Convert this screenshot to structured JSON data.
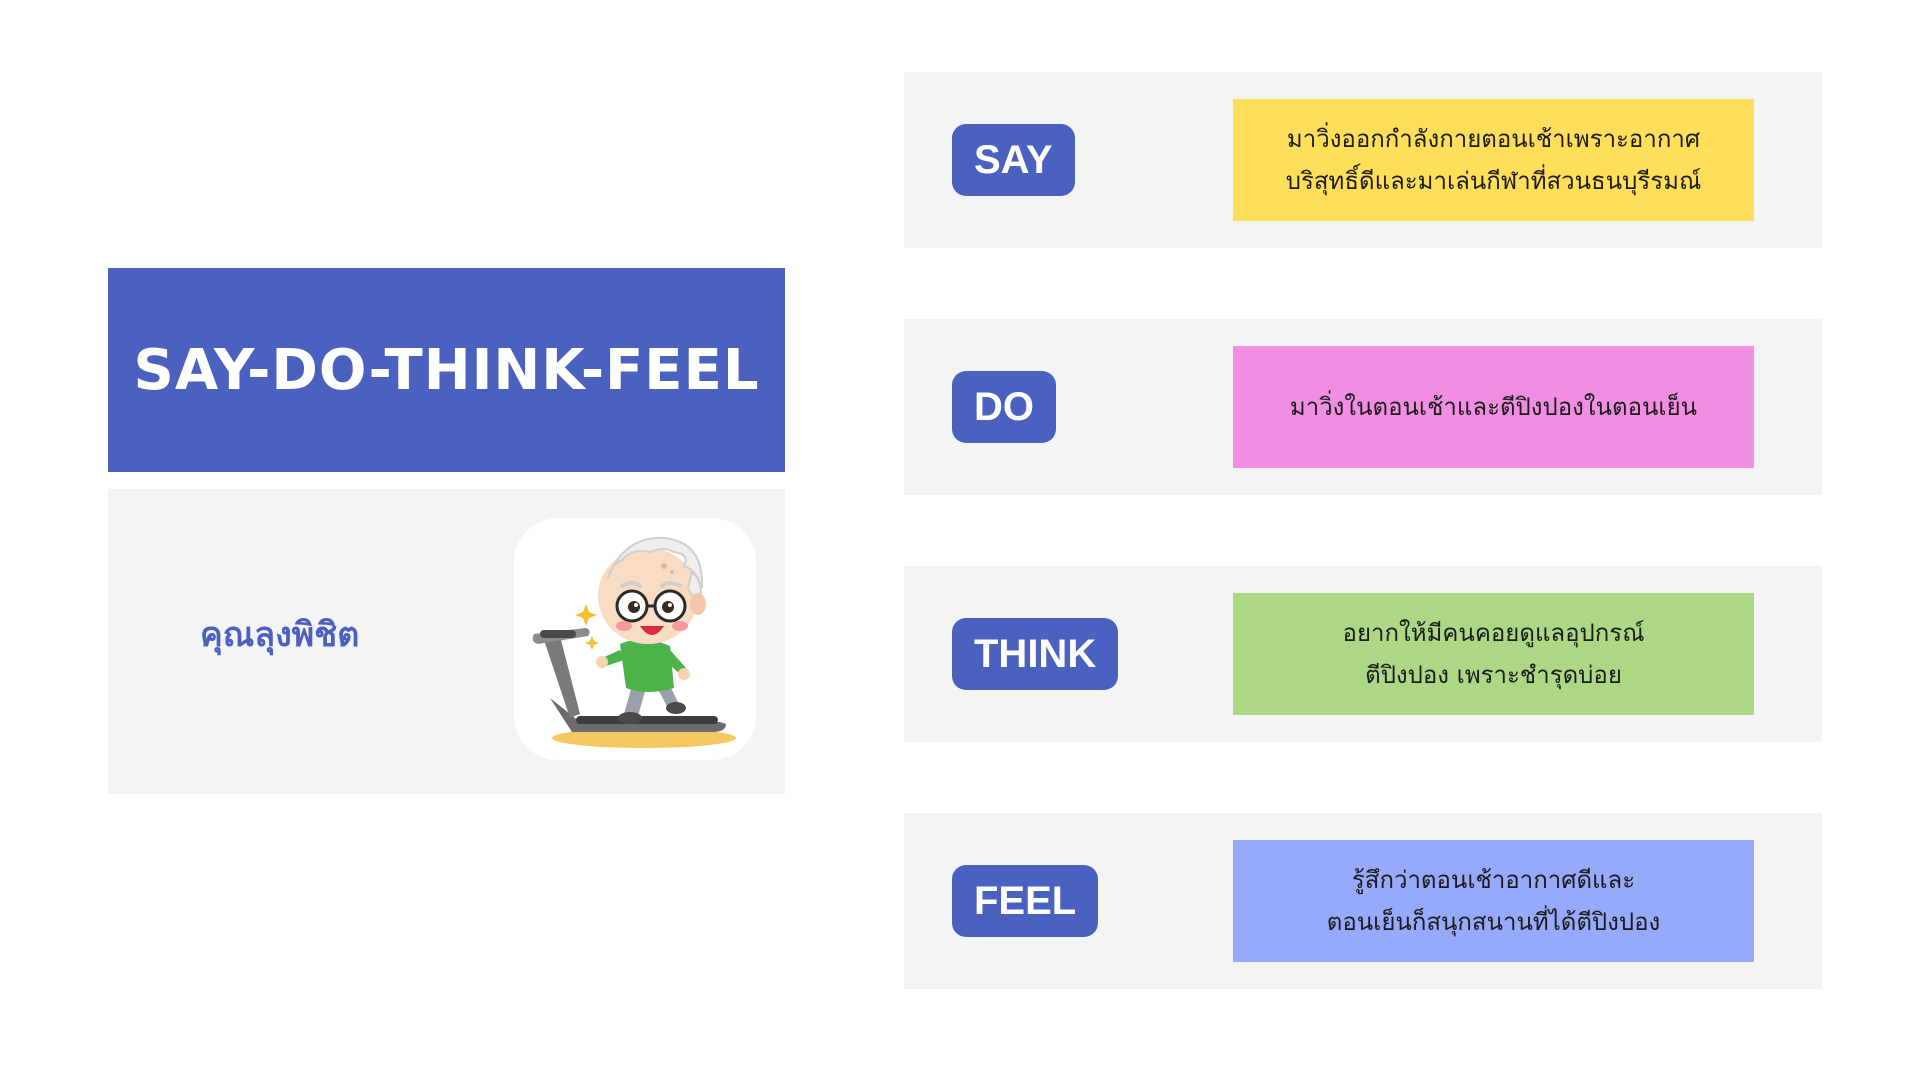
{
  "title": "SAY-DO-THINK-FEEL",
  "persona": {
    "name": "คุณลุงพิชิต",
    "avatar_icon": "elderly-man-on-treadmill-illustration"
  },
  "colors": {
    "accent": "#4b61c0",
    "panel": "#f4f4f4",
    "say": "#ffde59",
    "do": "#f28ee2",
    "think": "#acd886",
    "feel": "#97a9fa"
  },
  "rows": [
    {
      "label": "SAY",
      "lines": [
        "มาวิ่งออกกำลังกายตอนเช้าเพราะอากาศ",
        "บริสุทธิ์ดีและมาเล่นกีฬาที่สวนธนบุรีรมณ์"
      ]
    },
    {
      "label": "DO",
      "lines": [
        "มาวิ่งในตอนเช้าและตีปิงปองในตอนเย็น"
      ]
    },
    {
      "label": "THINK",
      "lines": [
        "อยากให้มีคนคอยดูแลอุปกรณ์",
        "ตีปิงปอง เพราะชำรุดบ่อย"
      ]
    },
    {
      "label": "FEEL",
      "lines": [
        "รู้สึกว่าตอนเช้าอากาศดีและ",
        "ตอนเย็นก็สนุกสนานที่ได้ตีปิงปอง"
      ]
    }
  ]
}
